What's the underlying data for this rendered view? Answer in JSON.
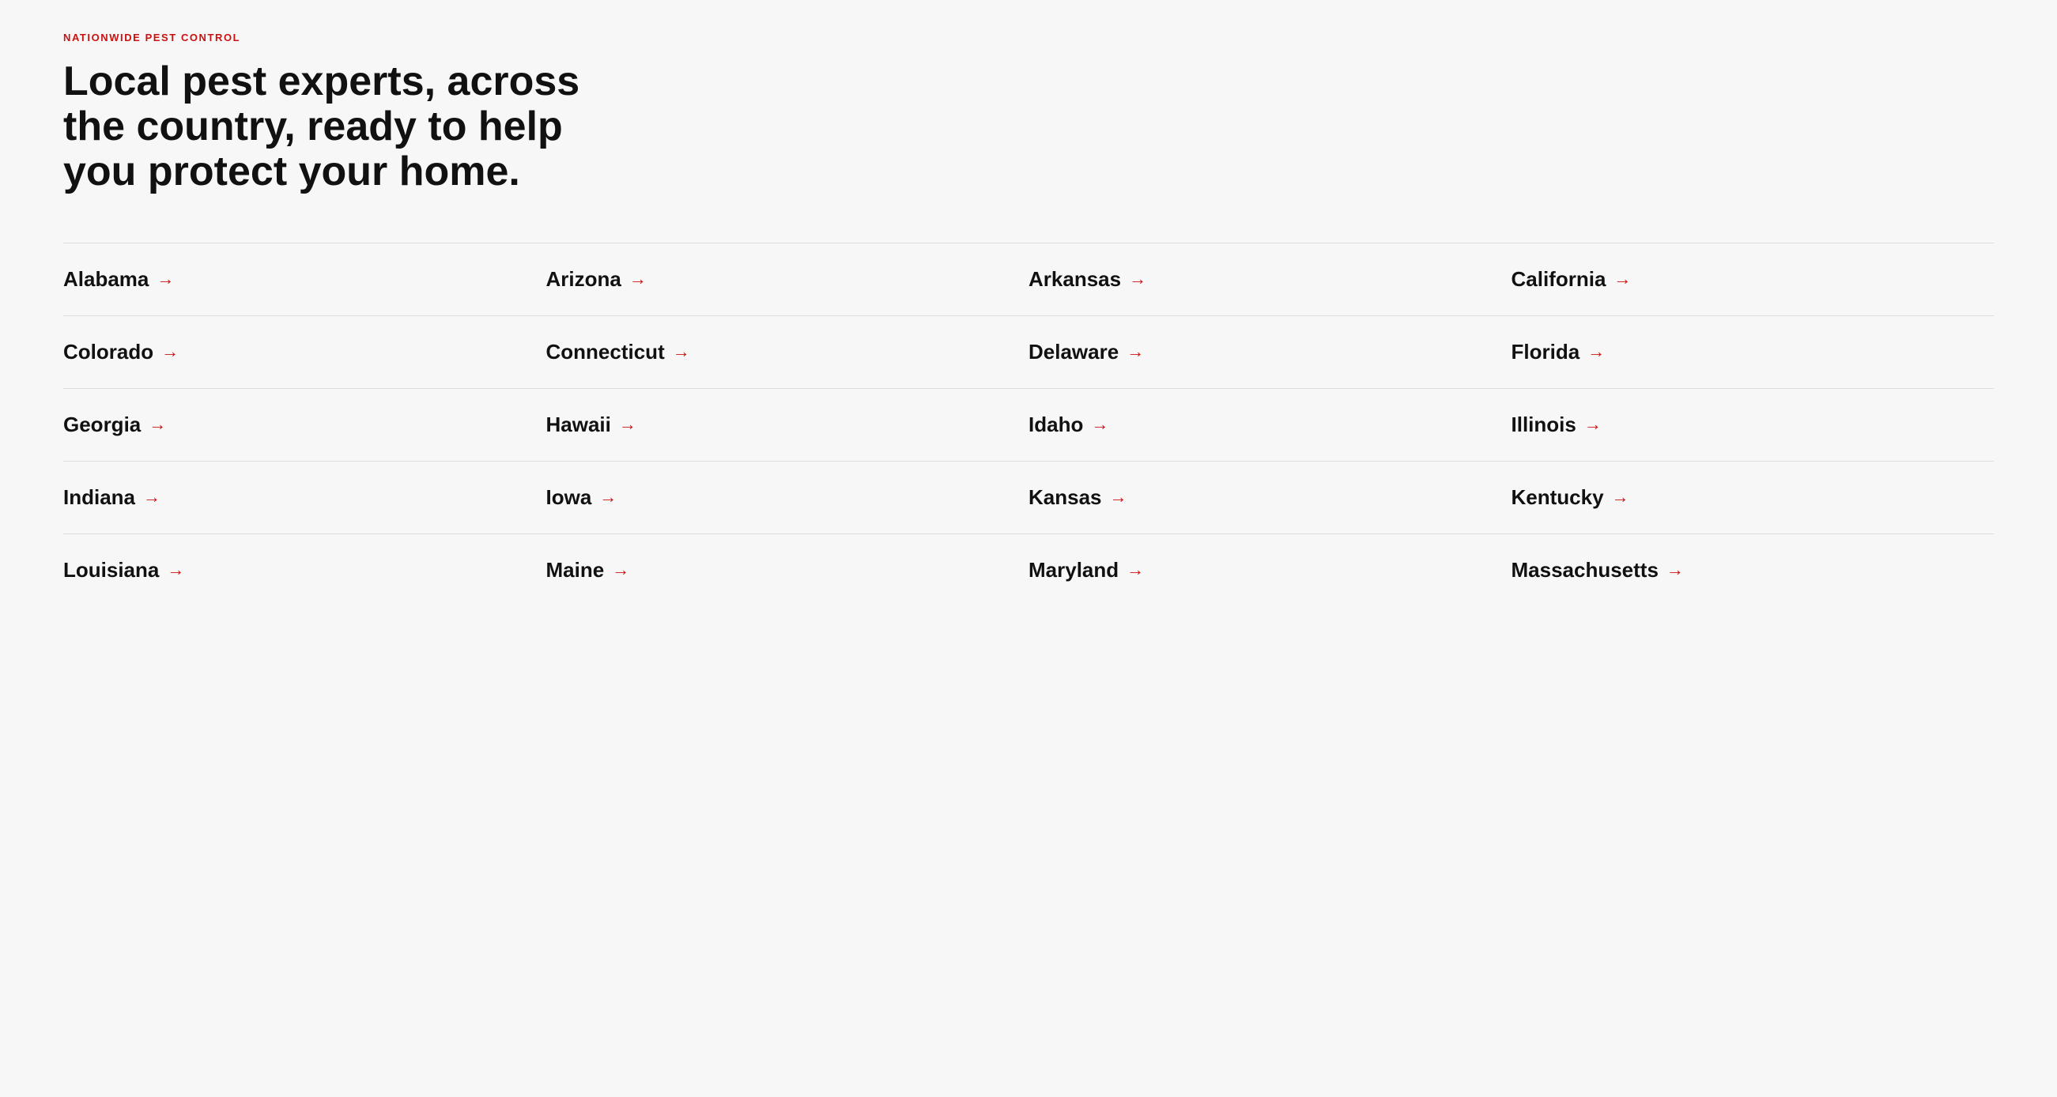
{
  "header": {
    "eyebrow": "NATIONWIDE PEST CONTROL",
    "headline": "Local pest experts, across the country, ready to help you protect your home."
  },
  "states": [
    {
      "name": "Alabama"
    },
    {
      "name": "Arizona"
    },
    {
      "name": "Arkansas"
    },
    {
      "name": "California"
    },
    {
      "name": "Colorado"
    },
    {
      "name": "Connecticut"
    },
    {
      "name": "Delaware"
    },
    {
      "name": "Florida"
    },
    {
      "name": "Georgia"
    },
    {
      "name": "Hawaii"
    },
    {
      "name": "Idaho"
    },
    {
      "name": "Illinois"
    },
    {
      "name": "Indiana"
    },
    {
      "name": "Iowa"
    },
    {
      "name": "Kansas"
    },
    {
      "name": "Kentucky"
    },
    {
      "name": "Louisiana"
    },
    {
      "name": "Maine"
    },
    {
      "name": "Maryland"
    },
    {
      "name": "Massachusetts"
    }
  ],
  "arrow": "→"
}
